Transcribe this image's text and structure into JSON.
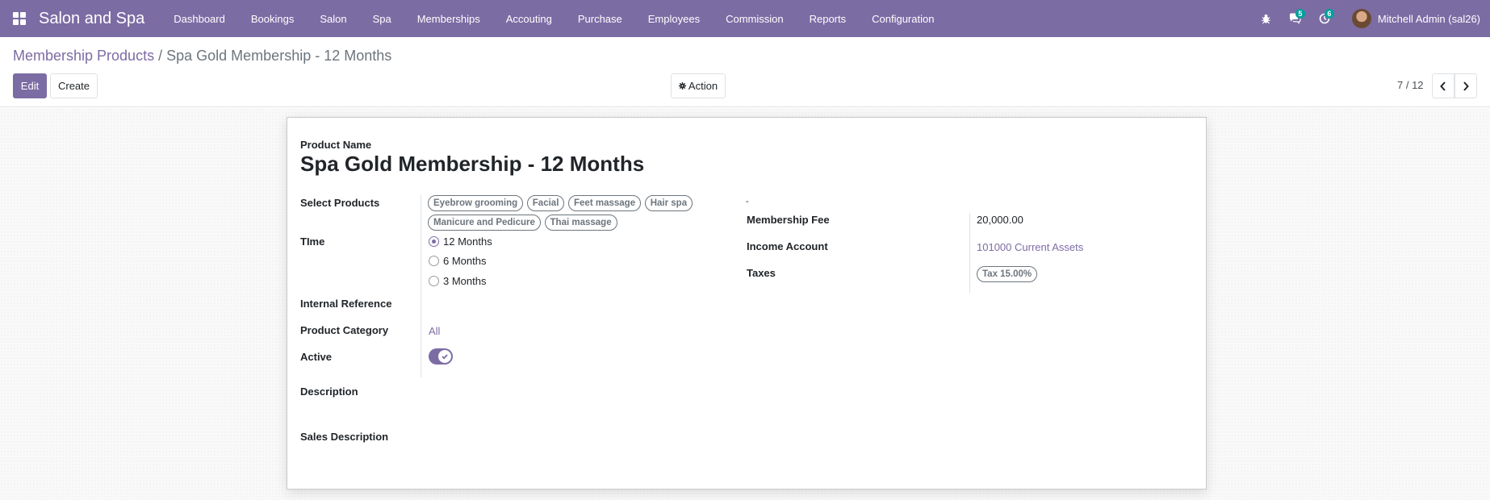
{
  "app": {
    "brand": "Salon and Spa",
    "menu": [
      "Dashboard",
      "Bookings",
      "Salon",
      "Spa",
      "Memberships",
      "Accouting",
      "Purchase",
      "Employees",
      "Commission",
      "Reports",
      "Configuration"
    ],
    "systray": {
      "messages_count": "5",
      "activities_count": "6",
      "user_name": "Mitchell Admin (sal26)"
    }
  },
  "control_panel": {
    "breadcrumb_parent": "Membership Products",
    "breadcrumb_separator": "/",
    "breadcrumb_current": "Spa Gold Membership - 12 Months",
    "edit_label": "Edit",
    "create_label": "Create",
    "action_label": "Action",
    "pager_value": "7 / 12"
  },
  "form": {
    "product_name_label": "Product Name",
    "product_name": "Spa Gold Membership - 12 Months",
    "select_products_label": "Select Products",
    "select_products": [
      "Eyebrow grooming",
      "Facial",
      "Feet massage",
      "Hair spa",
      "Manicure and Pedicure",
      "Thai massage"
    ],
    "time_label": "TIme",
    "time_options": [
      "12 Months",
      "6 Months",
      "3 Months"
    ],
    "time_selected": "12 Months",
    "internal_reference_label": "Internal Reference",
    "product_category_label": "Product Category",
    "product_category": "All",
    "active_label": "Active",
    "active": true,
    "description_label": "Description",
    "sales_description_label": "Sales Description",
    "right_dash": "-",
    "membership_fee_label": "Membership Fee",
    "membership_fee": "20,000.00",
    "income_account_label": "Income Account",
    "income_account": "101000 Current Assets",
    "taxes_label": "Taxes",
    "taxes": [
      "Tax 15.00%"
    ]
  },
  "colors": {
    "brand": "#7c6ca4",
    "badge": "#00a09d"
  }
}
